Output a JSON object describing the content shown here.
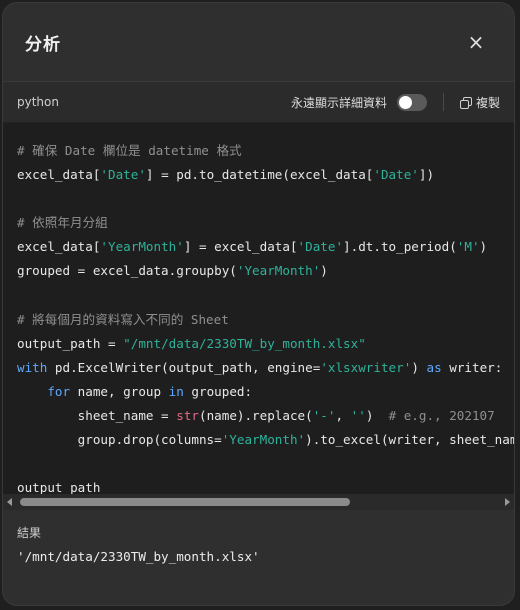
{
  "modal": {
    "title": "分析",
    "close_label": "×"
  },
  "toolbar": {
    "language": "python",
    "toggle_label": "永遠顯示詳細資料",
    "toggle_on": false,
    "copy_label": "複製"
  },
  "code": {
    "lines": [
      [
        [
          "cm",
          "# 確保 Date 欄位是 datetime 格式"
        ]
      ],
      [
        [
          "tx",
          "excel_data["
        ],
        [
          "st",
          "'Date'"
        ],
        [
          "tx",
          "] = pd.to_datetime(excel_data["
        ],
        [
          "st",
          "'Date'"
        ],
        [
          "tx",
          "])"
        ]
      ],
      [],
      [
        [
          "cm",
          "# 依照年月分組"
        ]
      ],
      [
        [
          "tx",
          "excel_data["
        ],
        [
          "st",
          "'YearMonth'"
        ],
        [
          "tx",
          "] = excel_data["
        ],
        [
          "st",
          "'Date'"
        ],
        [
          "tx",
          "].dt.to_period("
        ],
        [
          "st",
          "'M'"
        ],
        [
          "tx",
          ")"
        ]
      ],
      [
        [
          "tx",
          "grouped = excel_data.groupby("
        ],
        [
          "st",
          "'YearMonth'"
        ],
        [
          "tx",
          ")"
        ]
      ],
      [],
      [
        [
          "cm",
          "# 將每個月的資料寫入不同的 Sheet"
        ]
      ],
      [
        [
          "tx",
          "output_path = "
        ],
        [
          "st",
          "\"/mnt/data/2330TW_by_month.xlsx\""
        ]
      ],
      [
        [
          "kw",
          "with"
        ],
        [
          "tx",
          " pd.ExcelWriter(output_path, engine="
        ],
        [
          "st",
          "'xlsxwriter'"
        ],
        [
          "tx",
          ") "
        ],
        [
          "kw",
          "as"
        ],
        [
          "tx",
          " writer:"
        ]
      ],
      [
        [
          "tx",
          "    "
        ],
        [
          "kw",
          "for"
        ],
        [
          "tx",
          " name, group "
        ],
        [
          "kw",
          "in"
        ],
        [
          "tx",
          " grouped:"
        ]
      ],
      [
        [
          "tx",
          "        sheet_name = "
        ],
        [
          "bi",
          "str"
        ],
        [
          "tx",
          "(name).replace("
        ],
        [
          "st",
          "'-'"
        ],
        [
          "tx",
          ", "
        ],
        [
          "st",
          "''"
        ],
        [
          "tx",
          ")  "
        ],
        [
          "cm",
          "# e.g., 202107"
        ]
      ],
      [
        [
          "tx",
          "        group.drop(columns="
        ],
        [
          "st",
          "'YearMonth'"
        ],
        [
          "tx",
          ").to_excel(writer, sheet_name=sheet_name, index="
        ],
        [
          "kw",
          "False"
        ],
        [
          "tx",
          ")"
        ]
      ],
      [],
      [
        [
          "tx",
          "output_path"
        ]
      ]
    ]
  },
  "result": {
    "label": "結果",
    "value": "'/mnt/data/2330TW_by_month.xlsx'"
  }
}
